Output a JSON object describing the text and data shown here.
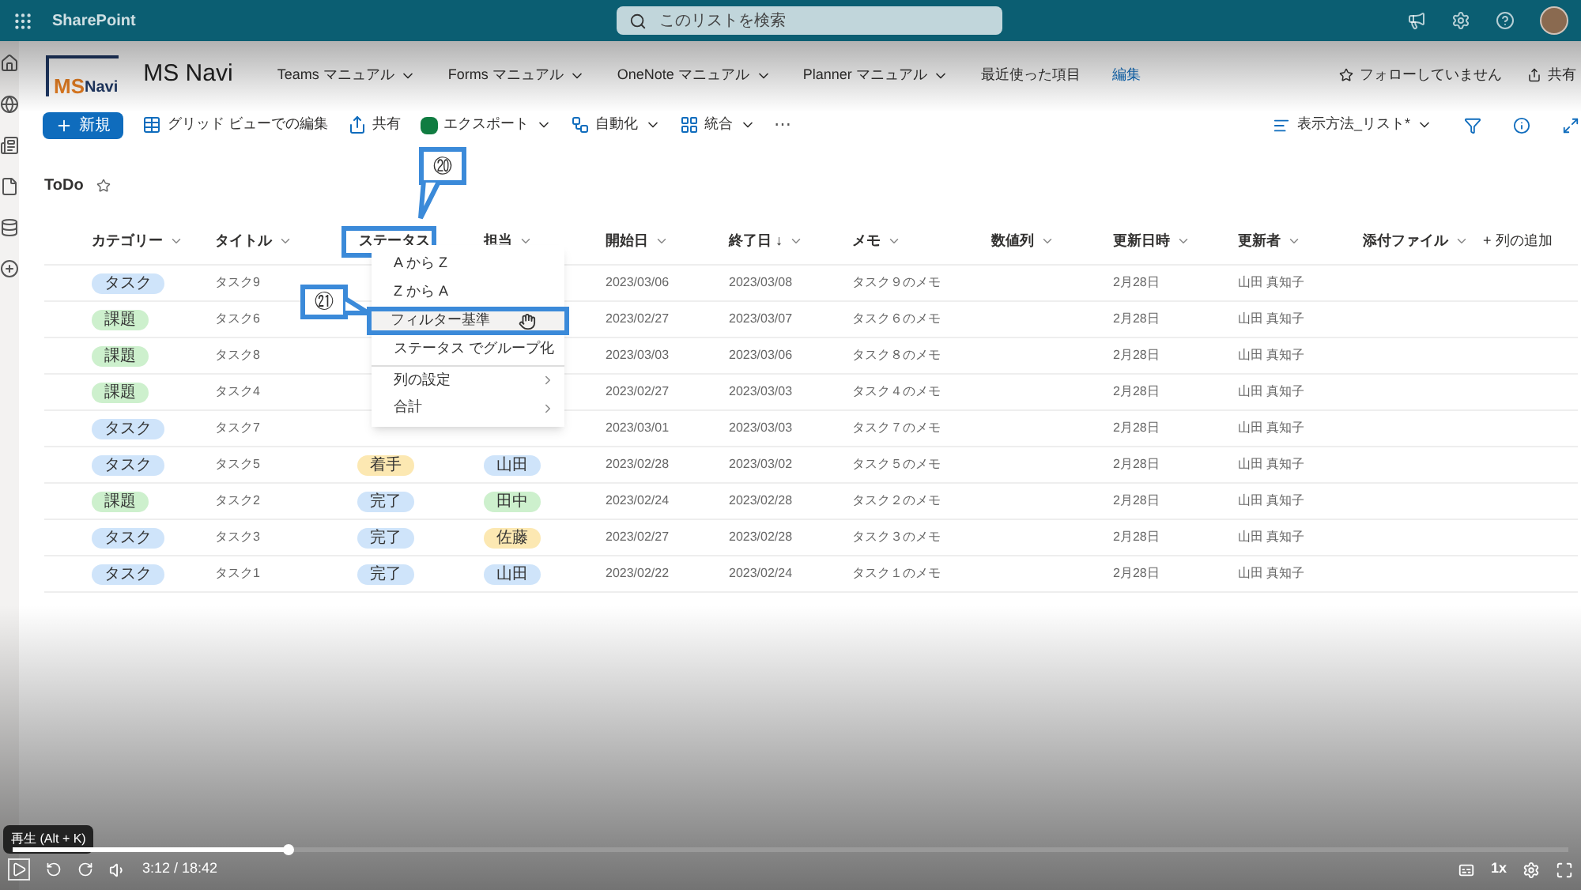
{
  "top_bar": {
    "app_name": "SharePoint",
    "search": {
      "placeholder": "このリストを検索"
    }
  },
  "site": {
    "logo": {
      "part1": "MS",
      "part2": "Navi"
    },
    "title": "MS Navi",
    "nav": [
      {
        "label": "Teams マニュアル",
        "dropdown": true
      },
      {
        "label": "Forms マニュアル",
        "dropdown": true
      },
      {
        "label": "OneNote マニュアル",
        "dropdown": true
      },
      {
        "label": "Planner マニュアル",
        "dropdown": true
      },
      {
        "label": "最近使った項目",
        "dropdown": false
      }
    ],
    "edit_link": "編集",
    "follow": "フォローしていません",
    "share": "共有"
  },
  "commands": [
    {
      "kind": "primary",
      "label": "新規"
    },
    {
      "kind": "grid",
      "label": "グリッド ビューでの編集"
    },
    {
      "kind": "share",
      "label": "共有"
    },
    {
      "kind": "excel",
      "label": "エクスポート",
      "dropdown": true
    },
    {
      "kind": "flow",
      "label": "自動化",
      "dropdown": true
    },
    {
      "kind": "integrate",
      "label": "統合",
      "dropdown": true
    },
    {
      "kind": "more",
      "label": "⋯"
    }
  ],
  "view_selector": "表示方法_リスト*",
  "list": {
    "title": "ToDo",
    "columns": [
      {
        "label": "カテゴリー"
      },
      {
        "label": "タイトル"
      },
      {
        "label": "ステータス",
        "highlighted": true
      },
      {
        "label": "担当"
      },
      {
        "label": "開始日"
      },
      {
        "label": "終了日 ↓"
      },
      {
        "label": "メモ"
      },
      {
        "label": "数値列"
      },
      {
        "label": "更新日時"
      },
      {
        "label": "更新者"
      },
      {
        "label": "添付ファイル"
      }
    ],
    "add_column": "+ 列の追加",
    "rows": [
      {
        "category": {
          "text": "タスク",
          "color": "#cfe4fa"
        },
        "title": "タスク9",
        "start": "2023/03/06",
        "end": "2023/03/08",
        "memo": "タスク９のメモ",
        "modified": "2月28日",
        "modified_by": "山田 真知子"
      },
      {
        "category": {
          "text": "課題",
          "color": "#cdf0cd"
        },
        "title": "タスク6",
        "start": "2023/02/27",
        "end": "2023/03/07",
        "memo": "タスク６のメモ",
        "modified": "2月28日",
        "modified_by": "山田 真知子"
      },
      {
        "category": {
          "text": "課題",
          "color": "#cdf0cd"
        },
        "title": "タスク8",
        "start": "2023/03/03",
        "end": "2023/03/06",
        "memo": "タスク８のメモ",
        "modified": "2月28日",
        "modified_by": "山田 真知子"
      },
      {
        "category": {
          "text": "課題",
          "color": "#cdf0cd"
        },
        "title": "タスク4",
        "start": "2023/02/27",
        "end": "2023/03/03",
        "memo": "タスク４のメモ",
        "modified": "2月28日",
        "modified_by": "山田 真知子"
      },
      {
        "category": {
          "text": "タスク",
          "color": "#cfe4fa"
        },
        "title": "タスク7",
        "start": "2023/03/01",
        "end": "2023/03/03",
        "memo": "タスク７のメモ",
        "modified": "2月28日",
        "modified_by": "山田 真知子"
      },
      {
        "category": {
          "text": "タスク",
          "color": "#cfe4fa"
        },
        "title": "タスク5",
        "status": {
          "text": "着手",
          "color": "#fce8b2"
        },
        "assignee": {
          "text": "山田",
          "color": "#cfe4fa"
        },
        "start": "2023/02/28",
        "end": "2023/03/02",
        "memo": "タスク５のメモ",
        "modified": "2月28日",
        "modified_by": "山田 真知子"
      },
      {
        "category": {
          "text": "課題",
          "color": "#cdf0cd"
        },
        "title": "タスク2",
        "status": {
          "text": "完了",
          "color": "#cfe4fa"
        },
        "assignee": {
          "text": "田中",
          "color": "#cdf0cd"
        },
        "start": "2023/02/24",
        "end": "2023/02/28",
        "memo": "タスク２のメモ",
        "modified": "2月28日",
        "modified_by": "山田 真知子"
      },
      {
        "category": {
          "text": "タスク",
          "color": "#cfe4fa"
        },
        "title": "タスク3",
        "status": {
          "text": "完了",
          "color": "#cfe4fa"
        },
        "assignee": {
          "text": "佐藤",
          "color": "#fce8b2"
        },
        "start": "2023/02/27",
        "end": "2023/02/28",
        "memo": "タスク３のメモ",
        "modified": "2月28日",
        "modified_by": "山田 真知子"
      },
      {
        "category": {
          "text": "タスク",
          "color": "#cfe4fa"
        },
        "title": "タスク1",
        "status": {
          "text": "完了",
          "color": "#cfe4fa"
        },
        "assignee": {
          "text": "山田",
          "color": "#cfe4fa"
        },
        "start": "2023/02/22",
        "end": "2023/02/24",
        "memo": "タスク１のメモ",
        "modified": "2月28日",
        "modified_by": "山田 真知子"
      }
    ]
  },
  "column_menu": {
    "items": [
      {
        "label": "A から Z",
        "submenu": false,
        "selected": false
      },
      {
        "label": "Z から A",
        "submenu": false,
        "selected": false
      },
      {
        "label": "フィルター基準",
        "submenu": false,
        "selected": true
      },
      {
        "label": "ステータス でグループ化",
        "submenu": false,
        "selected": false
      },
      {
        "label": "列の設定",
        "submenu": true,
        "selected": false
      },
      {
        "label": "合計",
        "submenu": true,
        "selected": false
      }
    ]
  },
  "callouts": [
    {
      "number": "⑳"
    },
    {
      "number": "㉑"
    }
  ],
  "player": {
    "tooltip": "再生 (Alt + K)",
    "time": "3:12 / 18:42",
    "speed": "1x",
    "progress": {
      "level": 0.177
    }
  }
}
